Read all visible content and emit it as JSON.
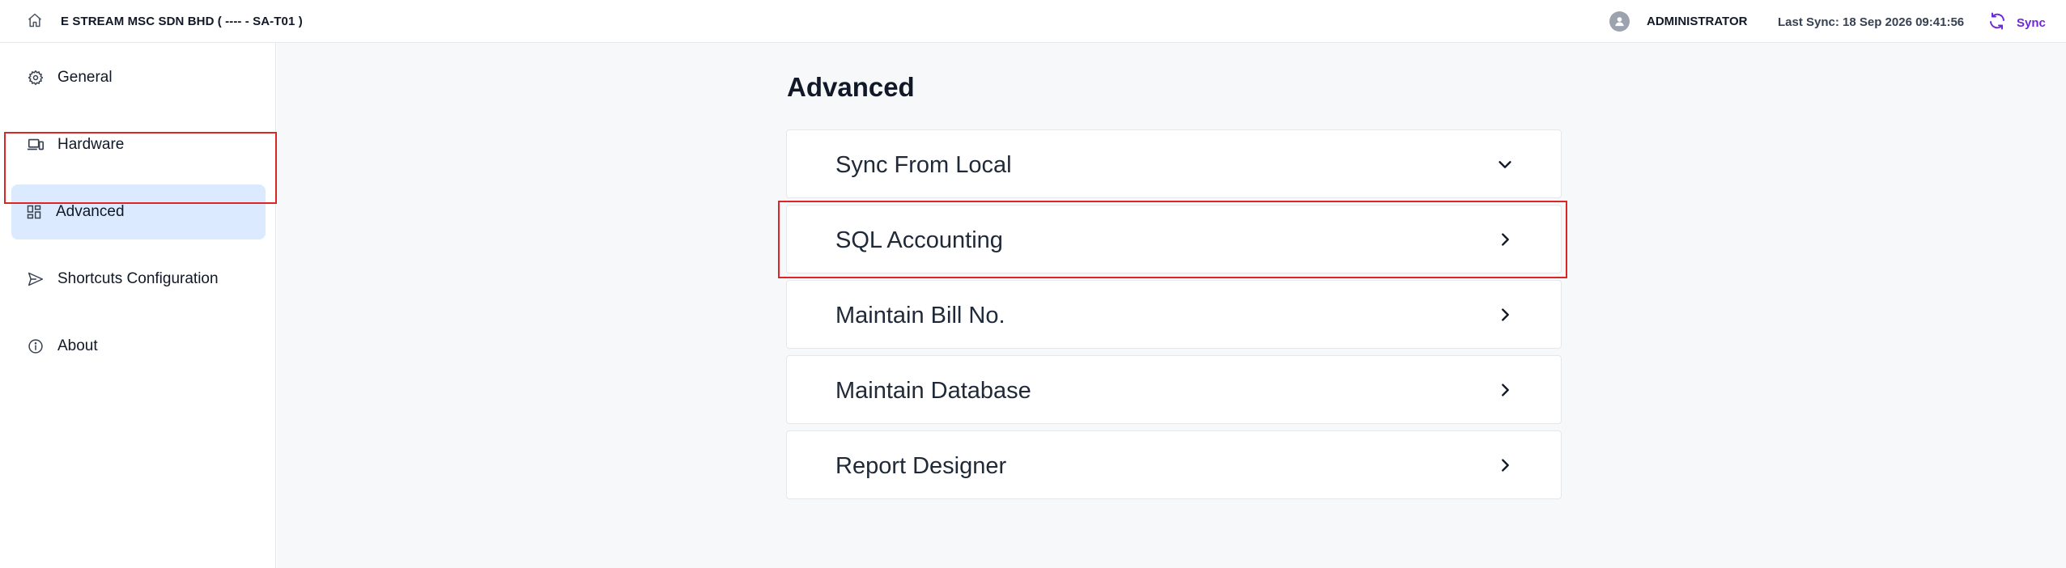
{
  "header": {
    "home_icon": "home-icon",
    "company_name": "E STREAM MSC SDN BHD ( ---- - SA-T01 )",
    "user_icon": "user-icon",
    "user_name": "ADMINISTRATOR",
    "last_sync": "Last Sync: 18 Sep 2026 09:41:56",
    "sync_icon": "refresh-icon",
    "sync_label": "Sync",
    "accent_color": "#6d28d9"
  },
  "sidebar": {
    "items": [
      {
        "label": "General",
        "icon": "gear-icon",
        "active": false
      },
      {
        "label": "Hardware",
        "icon": "devices-icon",
        "active": false
      },
      {
        "label": "Advanced",
        "icon": "grid-icon",
        "active": true
      },
      {
        "label": "Shortcuts Configuration",
        "icon": "send-icon",
        "active": false
      },
      {
        "label": "About",
        "icon": "info-icon",
        "active": false
      }
    ],
    "active_bg": "#dbeafe",
    "highlight_color": "#dc2626"
  },
  "main": {
    "title": "Advanced",
    "panels": [
      {
        "label": "Sync From Local",
        "chevron": "chevron-down-icon",
        "expanded": true
      },
      {
        "label": "SQL Accounting",
        "chevron": "chevron-right-icon",
        "expanded": false
      },
      {
        "label": "Maintain Bill No.",
        "chevron": "chevron-right-icon",
        "expanded": false
      },
      {
        "label": "Maintain Database",
        "chevron": "chevron-right-icon",
        "expanded": false
      },
      {
        "label": "Report Designer",
        "chevron": "chevron-right-icon",
        "expanded": false
      }
    ]
  }
}
